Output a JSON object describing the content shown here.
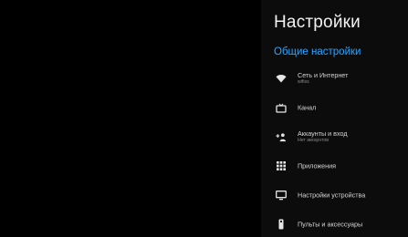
{
  "header": {
    "title": "Настройки"
  },
  "section": {
    "label": "Общие настройки"
  },
  "menu": {
    "items": [
      {
        "label": "Сеть и Интернет",
        "sub": "wifiss",
        "icon": "wifi-icon"
      },
      {
        "label": "Канал",
        "sub": "",
        "icon": "tv-icon"
      },
      {
        "label": "Аккаунты и вход",
        "sub": "Нет аккаунтов",
        "icon": "add-account-icon"
      },
      {
        "label": "Приложения",
        "sub": "",
        "icon": "apps-grid-icon"
      },
      {
        "label": "Настройки устройства",
        "sub": "",
        "icon": "monitor-icon"
      },
      {
        "label": "Пульты и аксессуары",
        "sub": "",
        "icon": "remote-icon"
      }
    ]
  },
  "colors": {
    "accent": "#2fa4ff",
    "panel": "#0c0c0c",
    "background": "#000000"
  }
}
